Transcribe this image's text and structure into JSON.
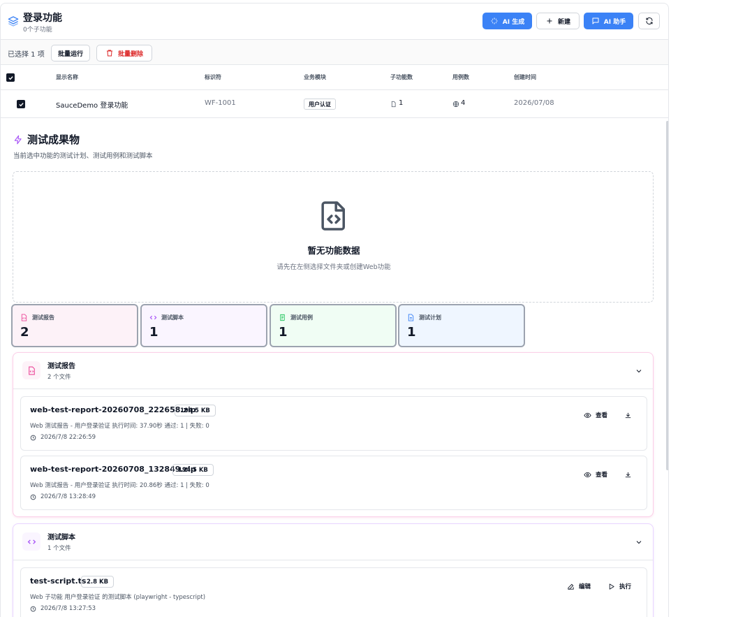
{
  "header": {
    "title": "登录功能",
    "subtitle": "0个子功能",
    "btn_ai_generate": "AI 生成",
    "btn_new": "新建",
    "btn_ai_assistant": "AI 助手"
  },
  "toolbar": {
    "selected_text": "已选择 1 项",
    "batch_run": "批量运行",
    "batch_delete": "批量删除"
  },
  "table": {
    "headers": [
      "显示名称",
      "标识符",
      "业务模块",
      "子功能数",
      "用例数",
      "创建时间"
    ],
    "rows": [
      {
        "name": "SauceDemo 登录功能",
        "id": "WF-1001",
        "module": "用户认证",
        "sub_count": "1",
        "case_count": "4",
        "created": "2026/07/08"
      }
    ]
  },
  "artifacts": {
    "title": "测试成果物",
    "subtitle": "当前选中功能的测试计划、测试用例和测试脚本",
    "empty_title": "暂无功能数据",
    "empty_sub": "请先在左侧选择文件夹或创建Web功能"
  },
  "stats": [
    {
      "label": "测试报告",
      "value": "2",
      "color": "#ec4899",
      "bg": "#fdf2f8"
    },
    {
      "label": "测试脚本",
      "value": "1",
      "color": "#a855f7",
      "bg": "#faf5ff"
    },
    {
      "label": "测试用例",
      "value": "1",
      "color": "#22c55e",
      "bg": "#f0fdf4"
    },
    {
      "label": "测试计划",
      "value": "1",
      "color": "#3b82f6",
      "bg": "#eff6ff"
    }
  ],
  "groups": {
    "reports": {
      "title": "测试报告",
      "count": "2 个文件",
      "files": [
        {
          "name": "web-test-report-20260708_222658.zip",
          "size": "194.5 KB",
          "desc": "Web 测试报告 - 用户登录验证 执行时间: 37.90秒 通过: 1 | 失败: 0",
          "time": "2026/7/8 22:26:59",
          "action1": "查看"
        },
        {
          "name": "web-test-report-20260708_132849.zip",
          "size": "194.5 KB",
          "desc": "Web 测试报告 - 用户登录验证 执行时间: 20.86秒 通过: 1 | 失败: 0",
          "time": "2026/7/8 13:28:49",
          "action1": "查看"
        }
      ]
    },
    "scripts": {
      "title": "测试脚本",
      "count": "1 个文件",
      "files": [
        {
          "name": "test-script.ts",
          "size": "2.8 KB",
          "desc": "Web 子功能 用户登录验证 的测试脚本 (playwright - typescript)",
          "time": "2026/7/8 13:27:53",
          "action1": "编辑",
          "action2": "执行"
        }
      ]
    }
  }
}
